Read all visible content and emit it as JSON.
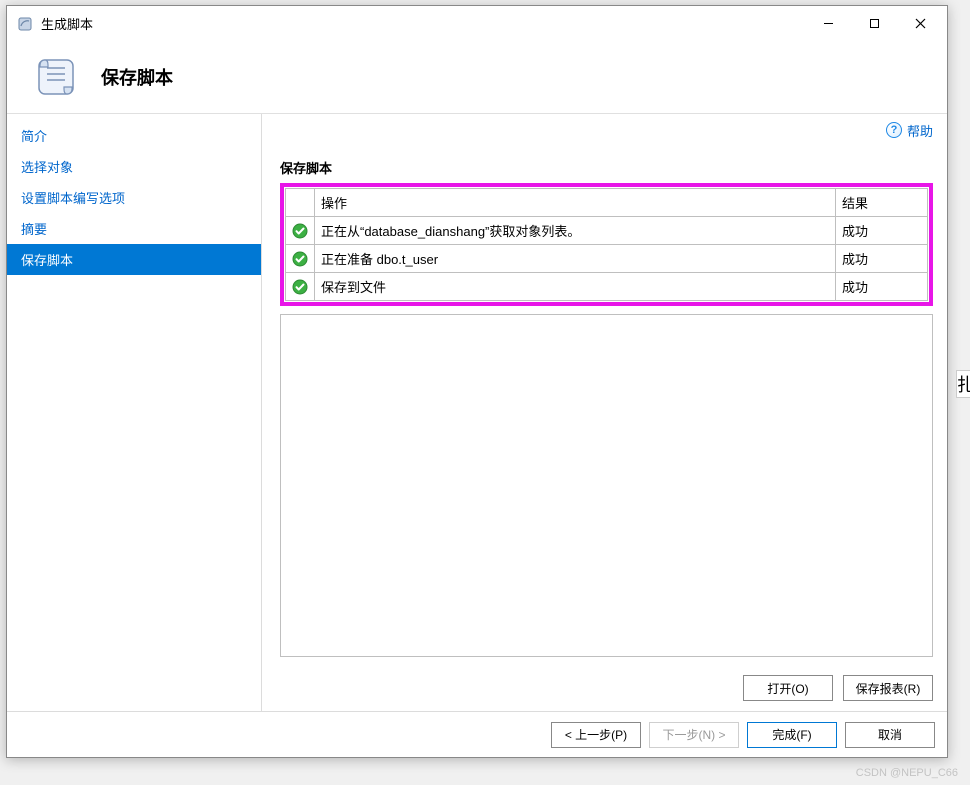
{
  "window": {
    "title": "生成脚本",
    "heading": "保存脚本"
  },
  "sidebar": {
    "items": [
      {
        "label": "简介"
      },
      {
        "label": "选择对象"
      },
      {
        "label": "设置脚本编写选项"
      },
      {
        "label": "摘要"
      },
      {
        "label": "保存脚本"
      }
    ],
    "selected_index": 4
  },
  "help": {
    "label": "帮助",
    "icon": "?"
  },
  "main": {
    "section_title": "保存脚本",
    "table": {
      "columns": {
        "action": "操作",
        "result": "结果"
      },
      "rows": [
        {
          "status": "success",
          "action": "正在从“database_dianshang”获取对象列表。",
          "result": "成功"
        },
        {
          "status": "success",
          "action": "正在准备 dbo.t_user",
          "result": "成功"
        },
        {
          "status": "success",
          "action": "保存到文件",
          "result": "成功"
        }
      ]
    },
    "buttons": {
      "open": "打开(O)",
      "save_report": "保存报表(R)"
    }
  },
  "footer": {
    "prev": "< 上一步(P)",
    "next": "下一步(N) >",
    "finish": "完成(F)",
    "cancel": "取消"
  },
  "watermark": "CSDN @NEPU_C66"
}
